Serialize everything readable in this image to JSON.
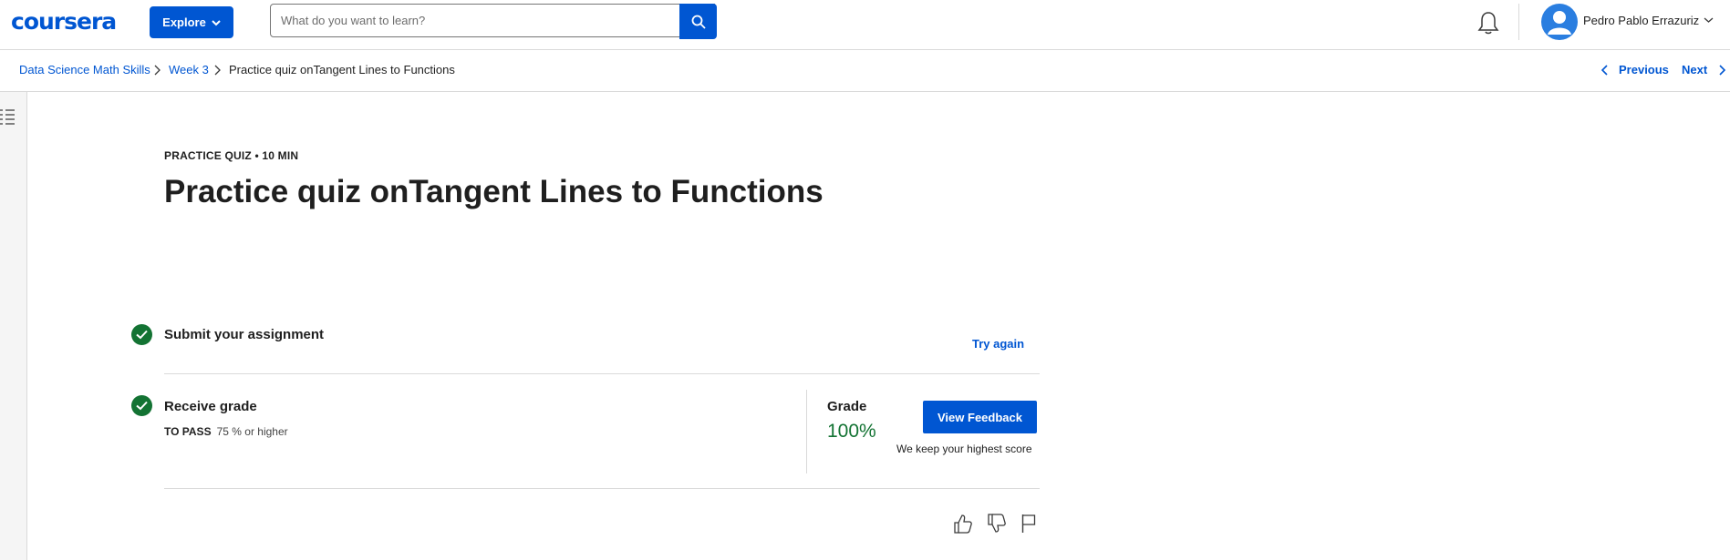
{
  "header": {
    "logo": "coursera",
    "explore_label": "Explore",
    "search_placeholder": "What do you want to learn?",
    "user_name": "Pedro Pablo Errazuriz"
  },
  "breadcrumb": {
    "items": [
      "Data Science Math Skills",
      "Week 3",
      "Practice quiz onTangent Lines to Functions"
    ],
    "previous_label": "Previous",
    "next_label": "Next"
  },
  "quiz": {
    "kicker": "PRACTICE QUIZ • 10 MIN",
    "title": "Practice quiz onTangent Lines to Functions",
    "submit_step": {
      "title": "Submit your assignment",
      "action_label": "Try again"
    },
    "grade_step": {
      "title": "Receive grade",
      "pass_label": "TO PASS",
      "pass_value": "75 % or higher",
      "grade_label": "Grade",
      "grade_value": "100%",
      "feedback_button": "View Feedback",
      "keep_score_note": "We keep your highest score"
    }
  },
  "colors": {
    "brand": "#0056d2",
    "success": "#137333"
  },
  "icons": [
    "chevron-down-icon",
    "search-icon",
    "bell-icon",
    "user-avatar-icon",
    "chevron-right-icon",
    "chevron-left-icon",
    "list-icon",
    "check-icon",
    "thumbs-up-icon",
    "thumbs-down-icon",
    "flag-icon"
  ]
}
